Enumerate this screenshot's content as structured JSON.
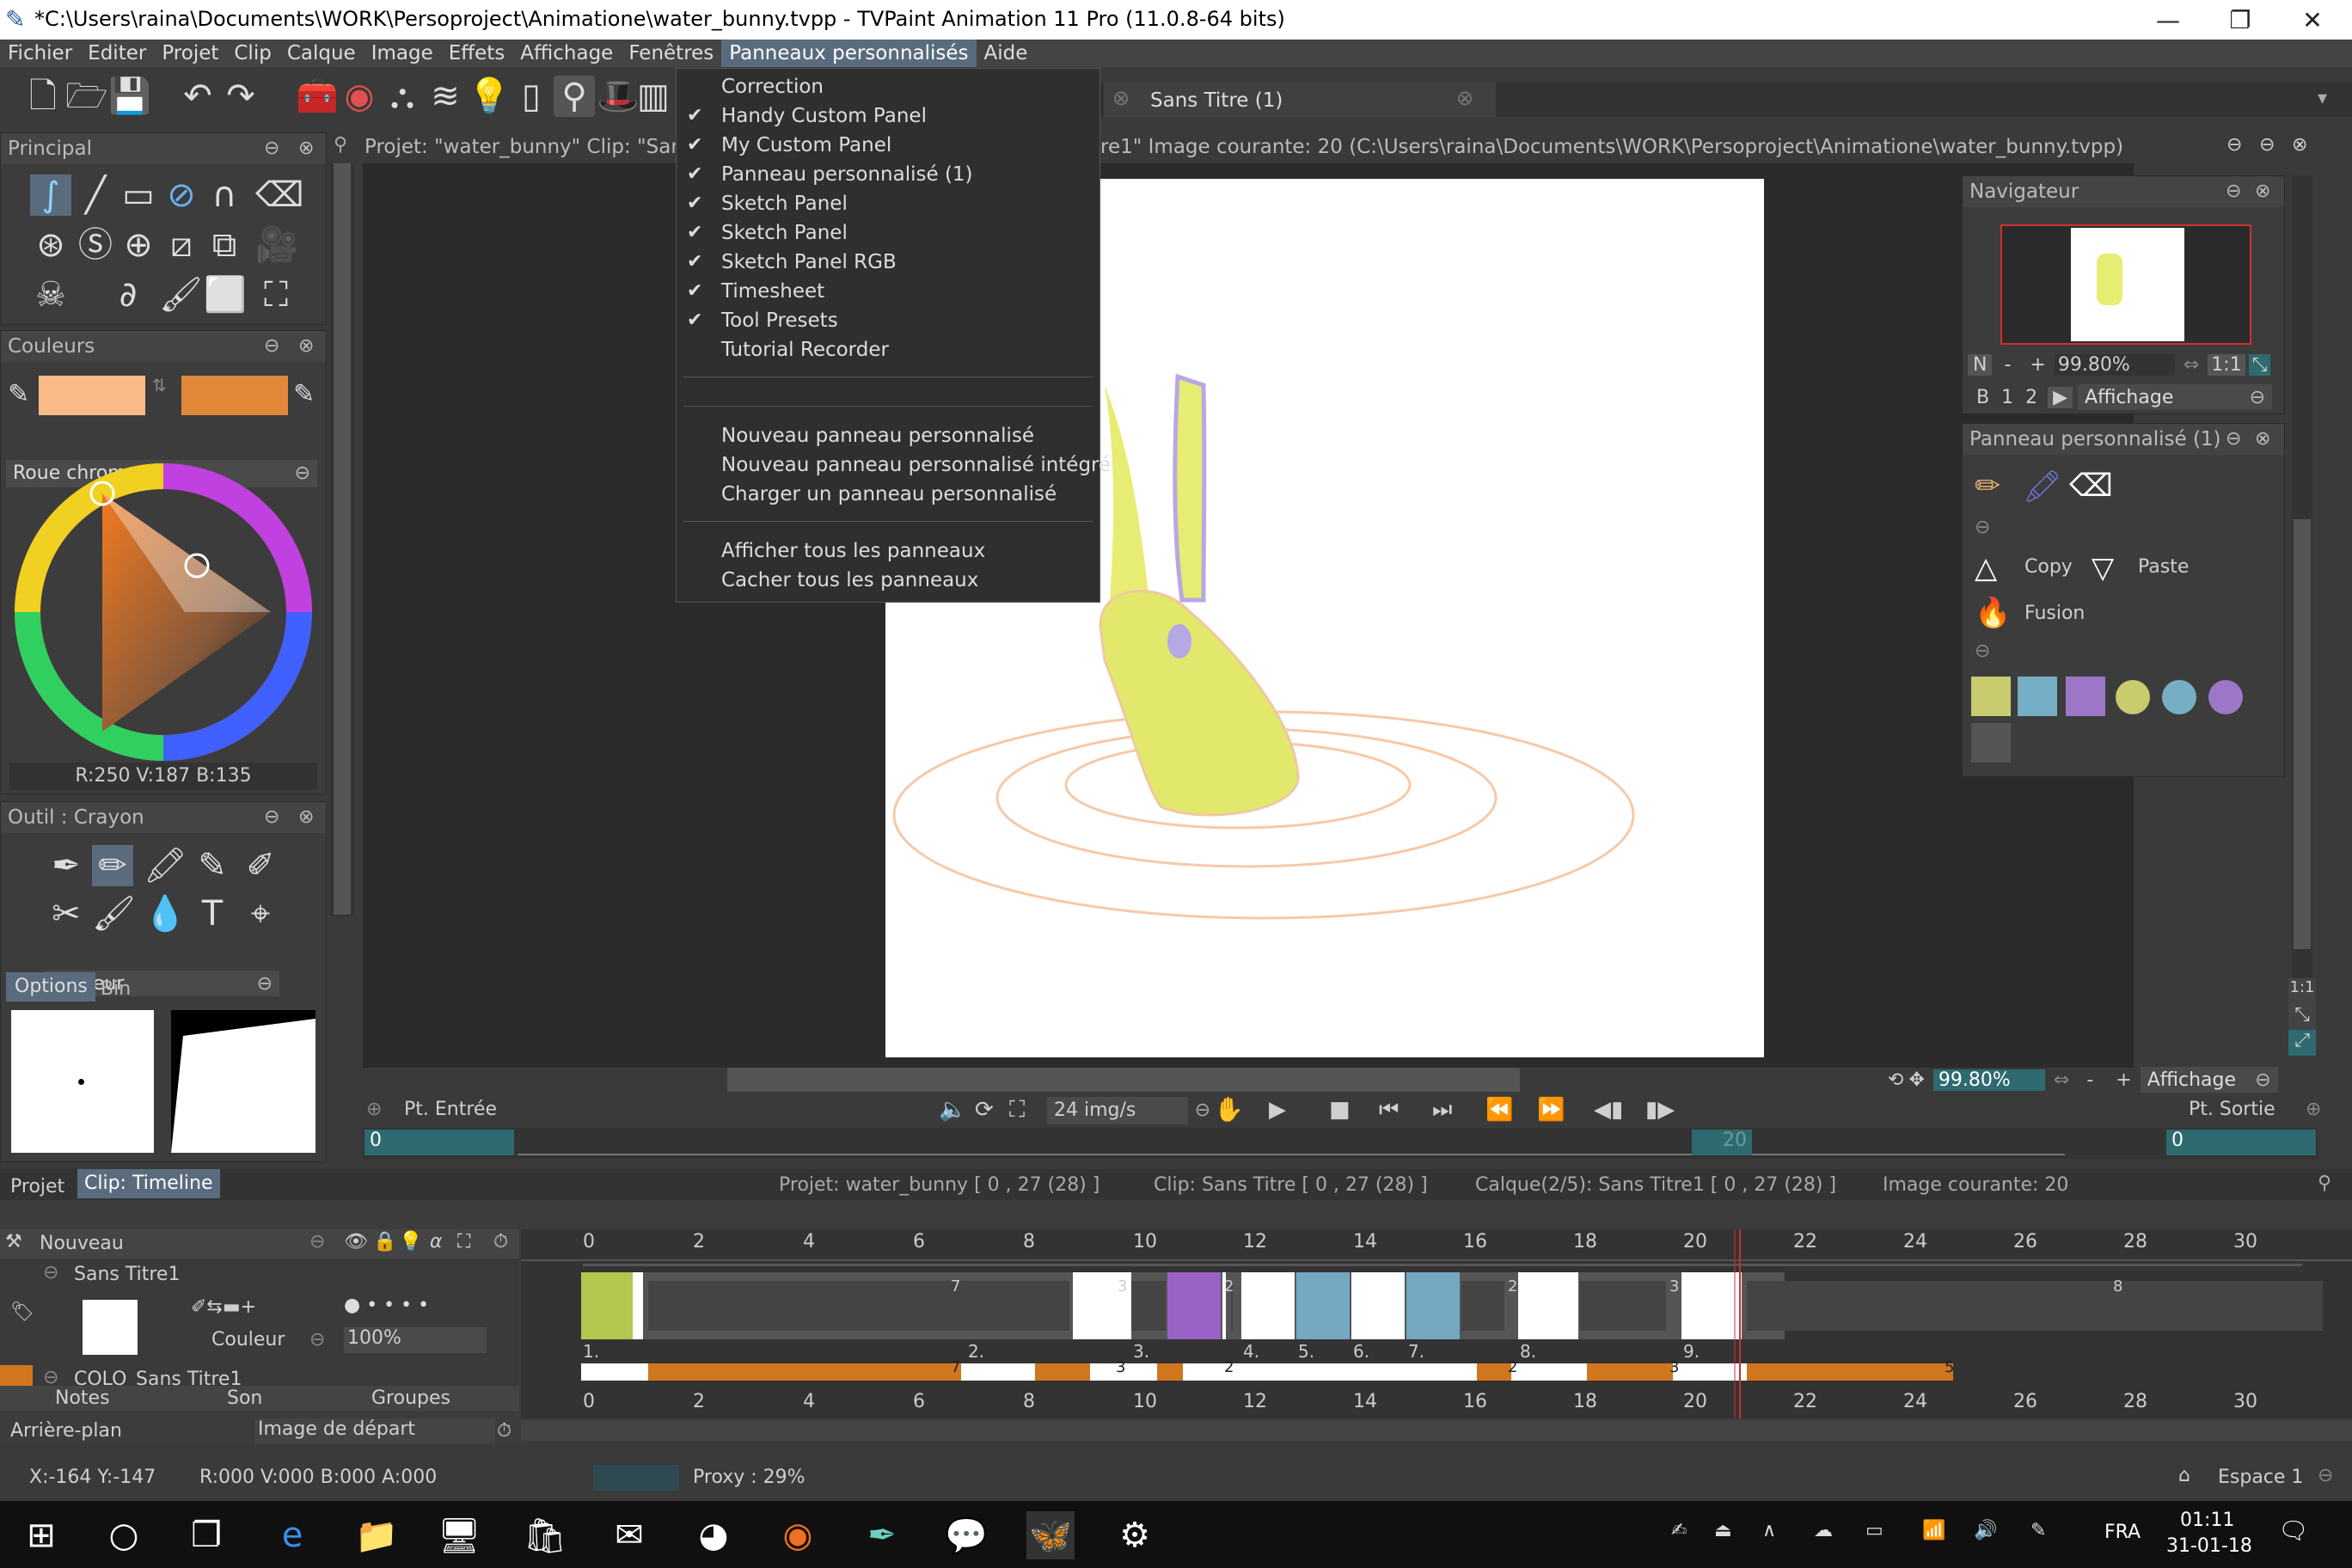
{
  "window": {
    "title": "*C:\\Users\\raina\\Documents\\WORK\\Persoproject\\Animatione\\water_bunny.tvpp - TVPaint Animation 11 Pro (11.0.8-64 bits)",
    "controls": [
      "—",
      "❐",
      "✕"
    ]
  },
  "menubar": [
    "Fichier",
    "Editer",
    "Projet",
    "Clip",
    "Calque",
    "Image",
    "Effets",
    "Affichage",
    "Fenêtres",
    "Panneaux personnalisés",
    "Aide"
  ],
  "custom_panels_menu": {
    "items": [
      {
        "label": "Correction",
        "checked": false
      },
      {
        "label": "Handy Custom Panel",
        "checked": true
      },
      {
        "label": "My Custom Panel",
        "checked": true
      },
      {
        "label": "Panneau personnalisé (1)",
        "checked": true
      },
      {
        "label": "Sketch Panel",
        "checked": true
      },
      {
        "label": "Sketch Panel",
        "checked": true
      },
      {
        "label": "Sketch Panel RGB",
        "checked": true
      },
      {
        "label": "Timesheet",
        "checked": true
      },
      {
        "label": "Tool Presets",
        "checked": true
      },
      {
        "label": "Tutorial Recorder",
        "checked": false
      }
    ],
    "new_items": [
      "Nouveau panneau personnalisé",
      "Nouveau panneau personnalisé intégré",
      "Charger un panneau personnalisé"
    ],
    "show_hide": [
      "Afficher tous les panneaux",
      "Cacher tous les panneaux"
    ]
  },
  "tabs": {
    "doc_tab": "Sans Titre (1)"
  },
  "left": {
    "principal_title": "Principal",
    "colors_title": "Couleurs",
    "color_a": "#fbbb87",
    "color_b": "#e08838",
    "wheel_mode": "Roue chromatique",
    "rgb_readout": "R:250 V:187 B:135",
    "tool_title": "Outil : Crayon",
    "tool_mode": "Couleur",
    "options_tab": "Options",
    "bin_tab": "Bin"
  },
  "canvas": {
    "info": "Projet: \"water_bunny\" Clip: \"San",
    "info_right": "re1\" Image courante: 20 (C:\\Users\\raina\\Documents\\WORK\\Persoproject\\Animatione\\water_bunny.tvpp)",
    "zoom": "99.80%",
    "view": "Affichage",
    "in_label": "Pt. Entrée",
    "out_label": "Pt. Sortie",
    "fps": "24 img/s",
    "in_value": "0",
    "out_value": "0",
    "frame_marker": "20"
  },
  "navigator": {
    "title": "Navigateur",
    "n": "N",
    "minus": "-",
    "plus": "+",
    "zoom": "99.80%",
    "ratio": "1:1",
    "b": "B",
    "one": "1",
    "two": "2",
    "view": "Affichage"
  },
  "custom_panel": {
    "title": "Panneau personnalisé (1)",
    "copy": "Copy",
    "paste": "Paste",
    "fusion": "Fusion",
    "swatches": [
      "#c8cb6e",
      "#76aec6",
      "#9d77c7",
      "#c8cb6e",
      "#76aec6",
      "#9d77c7",
      "#555555"
    ]
  },
  "timeline": {
    "tab_project": "Projet",
    "tab_clip": "Clip: Timeline",
    "status_project": "Projet: water_bunny [ 0 , 27  (28) ]",
    "status_clip": "Clip: Sans Titre [ 0 , 27  (28) ]",
    "status_layer": "Calque(2/5): Sans Titre1 [ 0 , 27  (28) ]",
    "status_image": "Image courante: 20",
    "new_label": "Nouveau",
    "layer_name": "Sans Titre1",
    "layer_mode": "Couleur",
    "layer_opacity": "100%",
    "colo_label": "COLO",
    "colo_name": "Sans Titre1",
    "notes": "Notes",
    "son": "Son",
    "groupes": "Groupes",
    "background": "Arrière-plan",
    "start_image": "Image de départ",
    "ruler": [
      "0",
      "2",
      "4",
      "6",
      "8",
      "10",
      "12",
      "14",
      "16",
      "18",
      "20",
      "22",
      "24",
      "26",
      "28",
      "30"
    ],
    "cells": [
      {
        "label": "1.",
        "hold": "7"
      },
      {
        "label": "2.",
        "hold": "3"
      },
      {
        "label": "3.",
        "hold": "2"
      },
      {
        "label": "4.",
        "hold": ""
      },
      {
        "label": "5.",
        "hold": ""
      },
      {
        "label": "6.",
        "hold": ""
      },
      {
        "label": "7.",
        "hold": "2"
      },
      {
        "label": "8.",
        "hold": "3"
      },
      {
        "label": "9.",
        "hold": "8"
      }
    ],
    "colo_holds": [
      "7",
      "3",
      "2",
      "2",
      "3",
      "5"
    ]
  },
  "statusbar": {
    "coords": "X:-164  Y:-147",
    "rgba": "R:000 V:000 B:000 A:000",
    "proxy": "Proxy : 29%",
    "space": "Espace 1"
  },
  "taskbar": {
    "lang": "FRA",
    "time": "01:11",
    "date": "31-01-18"
  }
}
